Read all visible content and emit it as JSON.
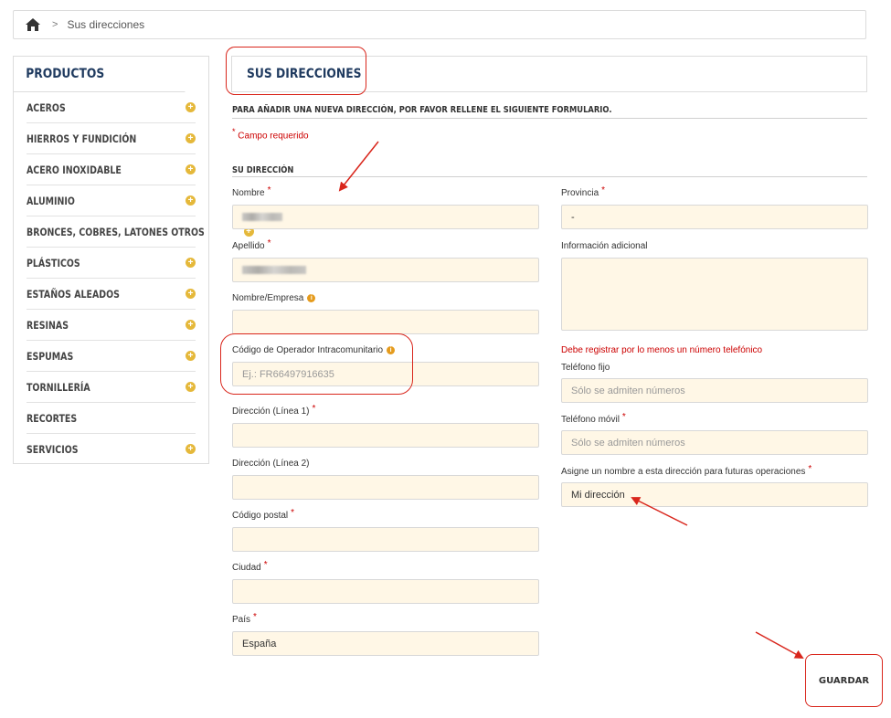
{
  "breadcrumb": {
    "separator": ">",
    "current": "Sus direcciones"
  },
  "sidebar": {
    "title": "PRODUCTOS",
    "items": [
      {
        "label": "ACEROS",
        "has_plus": true
      },
      {
        "label": "HIERROS Y FUNDICIÓN",
        "has_plus": true
      },
      {
        "label": "ACERO INOXIDABLE",
        "has_plus": true
      },
      {
        "label": "ALUMINIO",
        "has_plus": true
      },
      {
        "label": "BRONCES, COBRES, LATONES OTROS",
        "has_plus": true
      },
      {
        "label": "PLÁSTICOS",
        "has_plus": true
      },
      {
        "label": "ESTAÑOS ALEADOS",
        "has_plus": true
      },
      {
        "label": "RESINAS",
        "has_plus": true
      },
      {
        "label": "ESPUMAS",
        "has_plus": true
      },
      {
        "label": "TORNILLERÍA",
        "has_plus": true
      },
      {
        "label": "RECORTES",
        "has_plus": false
      },
      {
        "label": "SERVICIOS",
        "has_plus": true
      }
    ]
  },
  "page": {
    "title": "SUS DIRECCIONES",
    "intro": "PARA AÑADIR UNA NUEVA DIRECCIÓN, POR FAVOR RELLENE EL SIGUIENTE FORMULARIO.",
    "required_note": "Campo requerido",
    "required_mark": "*",
    "section_title": "SU DIRECCIÓN"
  },
  "form": {
    "nombre": {
      "label": "Nombre",
      "value": ""
    },
    "apellido": {
      "label": "Apellido",
      "value": ""
    },
    "empresa": {
      "label": "Nombre/Empresa",
      "value": ""
    },
    "vat": {
      "label": "Código de Operador Intracomunitario",
      "placeholder": "Ej.:  FR66497916635"
    },
    "direccion1": {
      "label": "Dirección (Línea 1)",
      "value": ""
    },
    "direccion2": {
      "label": "Dirección (Línea 2)",
      "value": ""
    },
    "cp": {
      "label": "Código postal",
      "value": ""
    },
    "ciudad": {
      "label": "Ciudad",
      "value": ""
    },
    "pais": {
      "label": "País",
      "value": "España"
    },
    "provincia": {
      "label": "Provincia",
      "value": "-"
    },
    "info_adicional": {
      "label": "Información adicional"
    },
    "phone_warning": "Debe registrar por lo menos un número telefónico",
    "telefono_fijo": {
      "label": "Teléfono fijo",
      "placeholder": "Sólo se admiten números"
    },
    "telefono_movil": {
      "label": "Teléfono móvil",
      "placeholder": "Sólo se admiten números"
    },
    "alias": {
      "label": "Asigne un nombre a esta dirección para futuras operaciones",
      "value": "Mi dirección"
    },
    "save_label": "GUARDAR"
  },
  "colors": {
    "accent_red": "#d9261c",
    "title_navy": "#1f3a5f",
    "input_bg": "#fff7e6",
    "plus_gold": "#e5b83a"
  }
}
